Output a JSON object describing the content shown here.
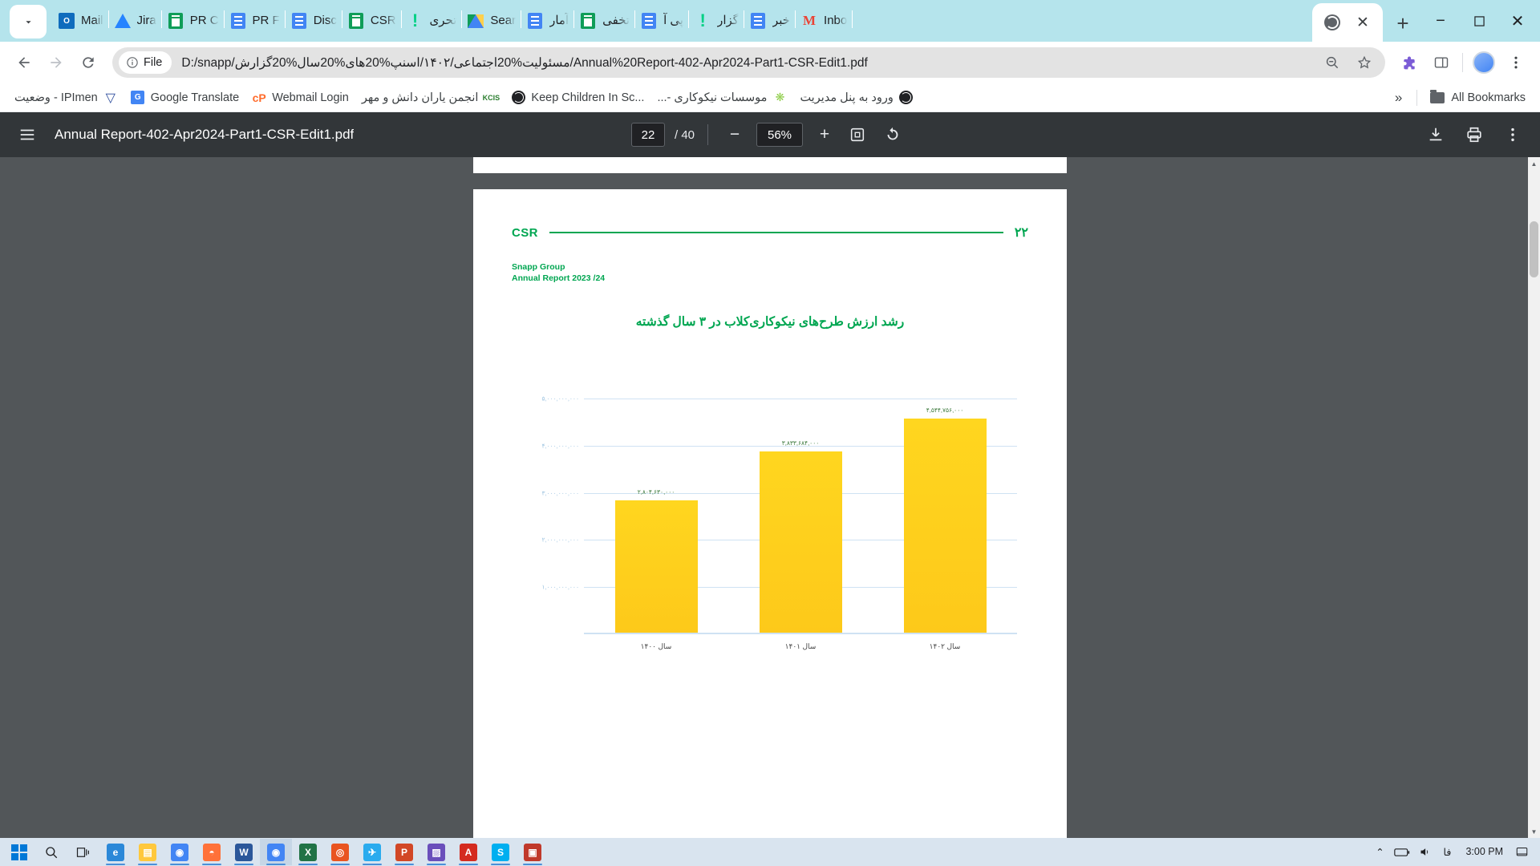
{
  "browser": {
    "tabs": [
      {
        "title": "Mail",
        "icon": "outlook-icon",
        "rtl": false
      },
      {
        "title": "Jira",
        "icon": "jira-icon",
        "rtl": false
      },
      {
        "title": "PR C",
        "icon": "google-sheets-icon",
        "rtl": false
      },
      {
        "title": "PR F",
        "icon": "google-docs-icon",
        "rtl": false
      },
      {
        "title": "Disc",
        "icon": "google-docs-icon",
        "rtl": false
      },
      {
        "title": "CSR",
        "icon": "google-sheets-icon",
        "rtl": false
      },
      {
        "title": "تحری",
        "icon": "exclamation-icon",
        "rtl": true
      },
      {
        "title": "Sear",
        "icon": "google-drive-icon",
        "rtl": false
      },
      {
        "title": "آمار",
        "icon": "google-docs-icon",
        "rtl": true
      },
      {
        "title": "تخفی",
        "icon": "google-sheets-icon",
        "rtl": true
      },
      {
        "title": "پی آ",
        "icon": "google-docs-icon",
        "rtl": true
      },
      {
        "title": "گزار",
        "icon": "exclamation-icon",
        "rtl": true
      },
      {
        "title": "خبر",
        "icon": "google-docs-icon",
        "rtl": true
      },
      {
        "title": "Inbo",
        "icon": "gmail-icon",
        "rtl": false
      }
    ],
    "active_tab": {
      "icon": "globe-icon",
      "close_label": "✕"
    },
    "new_tab_label": "+",
    "window_controls": {
      "minimize": "−",
      "maximize": "▭",
      "close": "✕"
    },
    "omnibox": {
      "chip_label": "File",
      "chip_icon": "info-circle-icon",
      "url": "D:/snapp/مسئولیت%20اجتماعی/۱۴۰۲/اسنپ%20های%20سال%20گزارش/Annual%20Report-402-Apr2024-Part1-CSR-Edit1.pdf",
      "zoom_icon": "zoom-out-icon",
      "bookmark_icon": "star-icon"
    },
    "toolbar_icons": {
      "back": "back-arrow-icon",
      "forward": "forward-arrow-icon",
      "reload": "reload-icon",
      "extensions": "extensions-icon",
      "split": "split-screen-icon",
      "profile": "profile-avatar-icon",
      "menu": "three-dot-menu-icon"
    },
    "bookmarks": [
      {
        "label": "IPImen - وضعیت",
        "icon": "ipmen-icon",
        "rtl": true
      },
      {
        "label": "Google Translate",
        "icon": "google-translate-icon",
        "rtl": false
      },
      {
        "label": "Webmail Login",
        "icon": "cpanel-icon",
        "rtl": false
      },
      {
        "label": "انجمن یاران دانش و مهر",
        "icon": "kcis-icon",
        "rtl": true
      },
      {
        "label": "Keep Children In Sc...",
        "icon": "globe-dark-icon",
        "rtl": false
      },
      {
        "label": "موسسات نیکوکاری -...",
        "icon": "plant-icon",
        "rtl": true
      },
      {
        "label": "ورود به پنل مدیریت",
        "icon": "globe-dark-icon",
        "rtl": true
      }
    ],
    "bookmarks_overflow": "»",
    "all_bookmarks_label": "All Bookmarks",
    "all_bookmarks_icon": "folder-icon"
  },
  "pdf": {
    "menu_icon": "hamburger-menu-icon",
    "filename": "Annual Report-402-Apr2024-Part1-CSR-Edit1.pdf",
    "current_page": "22",
    "page_count": "/ 40",
    "zoom_out_label": "−",
    "zoom_level": "56%",
    "zoom_in_label": "+",
    "fit_icon": "fit-page-icon",
    "rotate_icon": "rotate-icon",
    "download_icon": "download-icon",
    "print_icon": "print-icon",
    "more_icon": "three-dot-menu-icon"
  },
  "document": {
    "header_tag": "CSR",
    "page_number": "۲۲",
    "org_line1": "Snapp Group",
    "org_line2": "Annual Report 2023 /24",
    "chart_title": "رشد ارزش طرح‌های نیکوکاری‌کلاب در ۳ سال گذشته"
  },
  "chart_data": {
    "type": "bar",
    "title": "رشد ارزش طرح‌های نیکوکاری‌کلاب در ۳ سال گذشته",
    "categories": [
      "سال ۱۴۰۰",
      "سال ۱۴۰۱",
      "سال ۱۴۰۲"
    ],
    "values": [
      2804630000,
      3833684000,
      4544756000
    ],
    "value_labels": [
      "۲,۸۰۴,۶۳۰,۰۰۰",
      "۳,۸۳۳,۶۸۴,۰۰۰",
      "۴,۵۴۴,۷۵۶,۰۰۰"
    ],
    "ytick_labels": [
      "۵,۰۰۰,۰۰۰,۰۰۰",
      "۴,۰۰۰,۰۰۰,۰۰۰",
      "۳,۰۰۰,۰۰۰,۰۰۰",
      "۲,۰۰۰,۰۰۰,۰۰۰",
      "۱,۰۰۰,۰۰۰,۰۰۰"
    ],
    "ytick_values": [
      5000000000,
      4000000000,
      3000000000,
      2000000000,
      1000000000
    ],
    "ylim": [
      0,
      5600000000
    ],
    "xlabel": "",
    "ylabel": "",
    "grid": true,
    "legend": "none",
    "bar_color": "#ffd219",
    "accent_color": "#00a651",
    "grid_color": "#cfe2f3"
  },
  "taskbar": {
    "start_icon": "windows-start-icon",
    "search_icon": "search-icon",
    "taskview_icon": "task-view-icon",
    "apps": [
      {
        "name": "edge-icon",
        "glyph": "e",
        "color": "#2b88d8"
      },
      {
        "name": "file-explorer-icon",
        "glyph": "▤",
        "color": "#ffc83d"
      },
      {
        "name": "chrome-icon",
        "glyph": "◉",
        "color": "#4285f4"
      },
      {
        "name": "firefox-icon",
        "glyph": "◓",
        "color": "#ff7139"
      },
      {
        "name": "word-icon",
        "glyph": "W",
        "color": "#2b579a"
      },
      {
        "name": "chrome-active-icon",
        "glyph": "◉",
        "color": "#4285f4"
      },
      {
        "name": "excel-icon",
        "glyph": "X",
        "color": "#217346"
      },
      {
        "name": "ubuntu-icon",
        "glyph": "◎",
        "color": "#e95420"
      },
      {
        "name": "telegram-icon",
        "glyph": "✈",
        "color": "#2aabee"
      },
      {
        "name": "powerpoint-icon",
        "glyph": "P",
        "color": "#d24726"
      },
      {
        "name": "photos-icon",
        "glyph": "▨",
        "color": "#6a4fbb"
      },
      {
        "name": "acrobat-icon",
        "glyph": "A",
        "color": "#d42b1f"
      },
      {
        "name": "skype-icon",
        "glyph": "S",
        "color": "#00aff0"
      },
      {
        "name": "app-icon",
        "glyph": "▣",
        "color": "#c0392b"
      }
    ],
    "tray": {
      "overflow": "⌃",
      "battery_icon": "battery-icon",
      "volume_icon": "volume-icon",
      "language": "فا",
      "time": "3:00 PM",
      "notification_icon": "notification-icon"
    }
  }
}
